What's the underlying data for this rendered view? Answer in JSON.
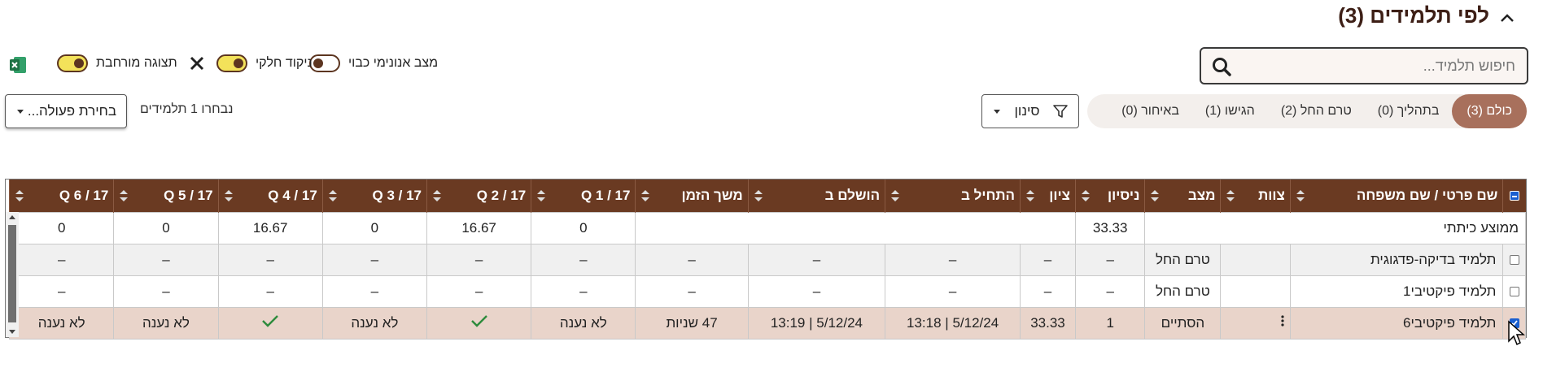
{
  "header": {
    "title": "לפי תלמידים (3)",
    "collapse_icon": "chevron-up-icon"
  },
  "toggles": [
    {
      "label": "מצב אנונימי כבוי",
      "on": false
    },
    {
      "label": "ניקוד חלקי",
      "on": true
    },
    {
      "label": "תצוגה מורחבת",
      "on": true
    }
  ],
  "search": {
    "placeholder": "חיפוש תלמיד..."
  },
  "tabs": [
    {
      "label": "כולם (3)",
      "active": true
    },
    {
      "label": "בתהליך (0)"
    },
    {
      "label": "טרם החל (2)"
    },
    {
      "label": "הגישו (1)"
    },
    {
      "label": "באיחור (0)"
    }
  ],
  "filter": {
    "label": "סינון"
  },
  "selection": {
    "count_text": "נבחרו 1 תלמידים"
  },
  "action": {
    "label": "בחירת פעולה..."
  },
  "colors": {
    "header_bg": "#6a3a22",
    "accent": "#a8705c",
    "selected_row": "#e9d4ca",
    "toggle_on": "#f3e25a"
  },
  "table": {
    "columns": [
      "שם פרטי  / שם משפחה",
      "צוות",
      "מצב",
      "ניסיון",
      "ציון",
      "התחיל ב",
      "הושלם ב",
      "משך הזמן",
      "Q 1 / 17",
      "Q 2 / 17",
      "Q 3 / 17",
      "Q 4 / 17",
      "Q 5 / 17",
      "Q 6 / 17"
    ],
    "average_row": {
      "label": "ממוצע כיתתי",
      "score": "33.33",
      "q": [
        "0",
        "16.67",
        "0",
        "16.67",
        "0",
        "0"
      ]
    },
    "rows": [
      {
        "name": "תלמיד בדיקה-פדגוגית",
        "status": "טרם החל",
        "attempt": "–",
        "score": "–",
        "started": "–",
        "completed": "–",
        "duration": "–",
        "q": [
          "–",
          "–",
          "–",
          "–",
          "–",
          "–"
        ],
        "checked": false
      },
      {
        "name": "תלמיד פיקטיבי1",
        "status": "טרם החל",
        "attempt": "–",
        "score": "–",
        "started": "–",
        "completed": "–",
        "duration": "–",
        "q": [
          "–",
          "–",
          "–",
          "–",
          "–",
          "–"
        ],
        "checked": false
      },
      {
        "name": "תלמיד פיקטיבי6",
        "status": "הסתיים",
        "attempt": "1",
        "score": "33.33",
        "started": "5/12/24 | 13:18",
        "completed": "5/12/24 | 13:19",
        "duration": "47 שניות",
        "q": [
          "לא נענה",
          "check",
          "לא נענה",
          "check",
          "לא נענה",
          "לא נענה"
        ],
        "checked": true
      }
    ]
  }
}
